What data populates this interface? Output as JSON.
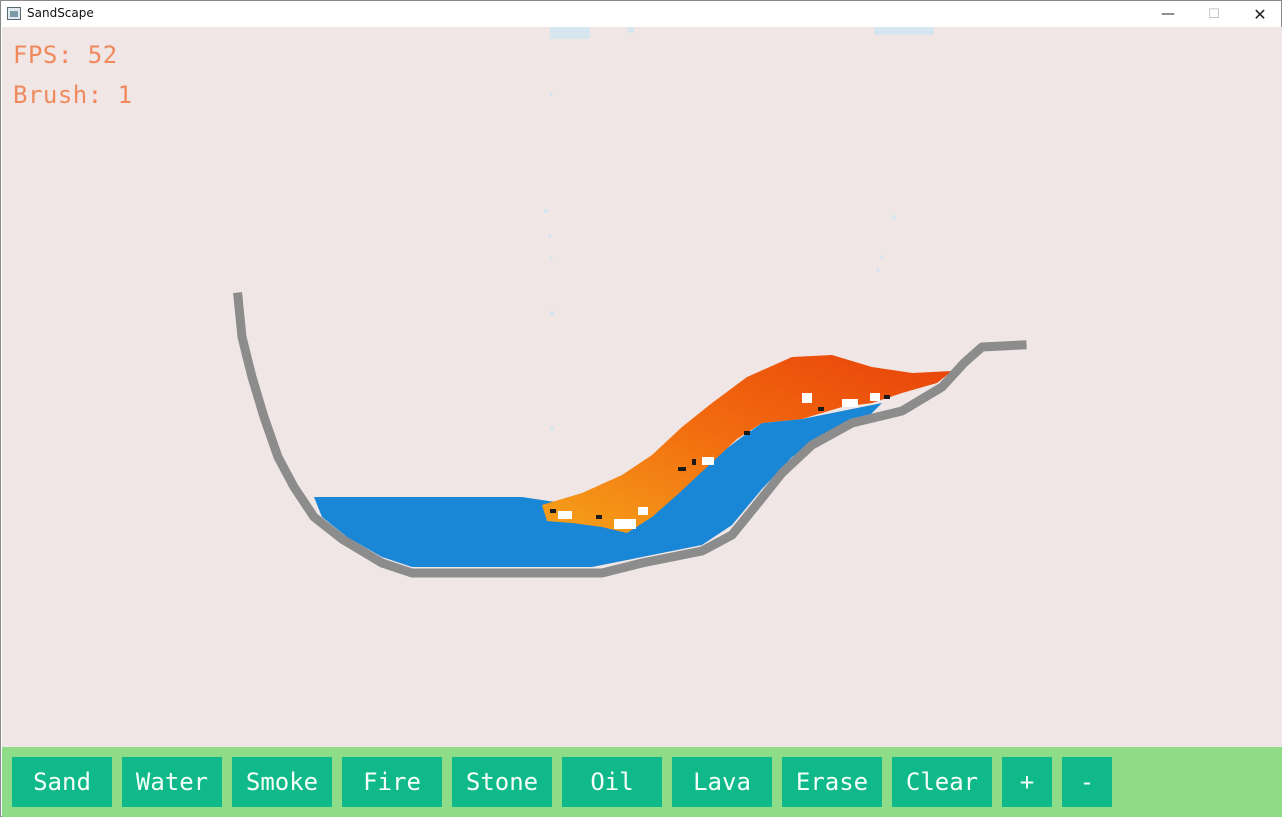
{
  "window": {
    "title": "SandScape",
    "controls": {
      "minimize": "—",
      "maximize": "☐",
      "close": "✕"
    }
  },
  "hud": {
    "fps": "FPS: 52",
    "brush": "Brush: 1"
  },
  "toolbar": {
    "buttons": [
      {
        "label": "Sand"
      },
      {
        "label": "Water"
      },
      {
        "label": "Smoke"
      },
      {
        "label": "Fire"
      },
      {
        "label": "Stone"
      },
      {
        "label": "Oil"
      },
      {
        "label": "Lava"
      },
      {
        "label": "Erase"
      },
      {
        "label": "Clear"
      },
      {
        "label": "+"
      },
      {
        "label": "-"
      }
    ]
  },
  "colors": {
    "canvas_bg": "#f1e6e6",
    "stone": "#8c8c8c",
    "water": "#1a86d6",
    "fire": "#f26b0f",
    "hud_text": "#f08a5d",
    "toolbar_bg": "#8fdc88",
    "button_bg": "#10b98a"
  }
}
